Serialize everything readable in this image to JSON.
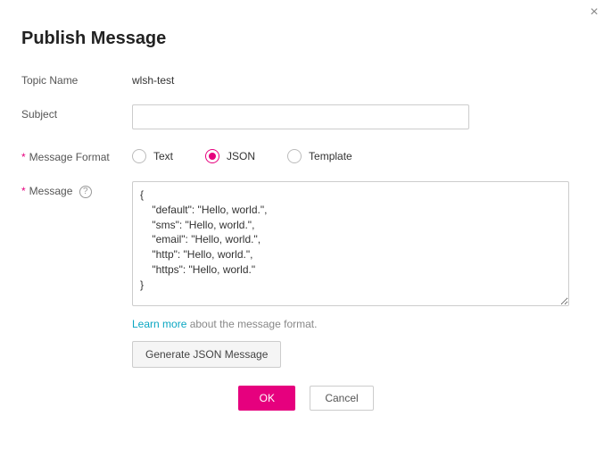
{
  "dialog": {
    "title": "Publish Message",
    "close_label": "×"
  },
  "labels": {
    "topic_name": "Topic Name",
    "subject": "Subject",
    "message_format": "Message Format",
    "message": "Message"
  },
  "values": {
    "topic_name": "wlsh-test",
    "subject": "",
    "message": "{\n    \"default\": \"Hello, world.\",\n    \"sms\": \"Hello, world.\",\n    \"email\": \"Hello, world.\",\n    \"http\": \"Hello, world.\",\n    \"https\": \"Hello, world.\"\n}"
  },
  "format_options": {
    "text": "Text",
    "json": "JSON",
    "template": "Template",
    "selected": "json"
  },
  "hint": {
    "link": "Learn more",
    "rest": " about the message format."
  },
  "buttons": {
    "generate": "Generate JSON Message",
    "ok": "OK",
    "cancel": "Cancel"
  }
}
